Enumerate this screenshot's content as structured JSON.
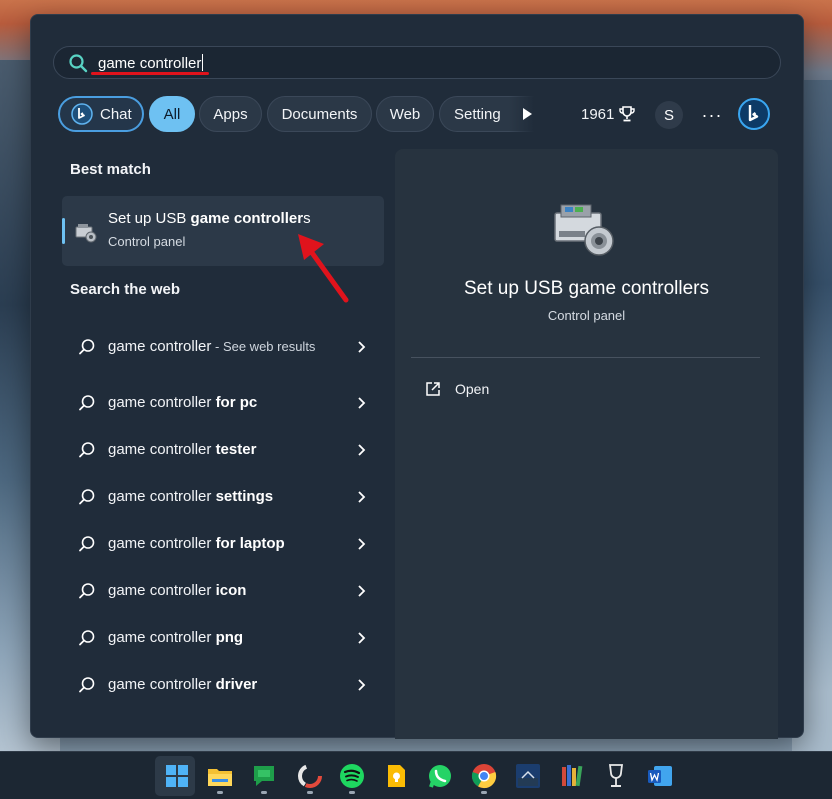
{
  "search": {
    "query": "game controller"
  },
  "filters": {
    "chat": "Chat",
    "all": "All",
    "apps": "Apps",
    "documents": "Documents",
    "web": "Web",
    "settings": "Setting",
    "points": "1961",
    "avatar_initial": "S",
    "more": "···"
  },
  "best_match": {
    "section_label": "Best match",
    "title_prefix": "Set up USB ",
    "title_bold": "game controller",
    "title_suffix": "s",
    "subtitle": "Control panel"
  },
  "search_web": {
    "section_label": "Search the web",
    "items": [
      {
        "prefix": "game controller",
        "bold": "",
        "suffix": " - See web results"
      },
      {
        "prefix": "game controller ",
        "bold": "for pc",
        "suffix": ""
      },
      {
        "prefix": "game controller ",
        "bold": "tester",
        "suffix": ""
      },
      {
        "prefix": "game controller ",
        "bold": "settings",
        "suffix": ""
      },
      {
        "prefix": "game controller ",
        "bold": "for laptop",
        "suffix": ""
      },
      {
        "prefix": "game controller ",
        "bold": "icon",
        "suffix": ""
      },
      {
        "prefix": "game controller ",
        "bold": "png",
        "suffix": ""
      },
      {
        "prefix": "game controller ",
        "bold": "driver",
        "suffix": ""
      }
    ]
  },
  "preview": {
    "title": "Set up USB game controllers",
    "subtitle": "Control panel",
    "open_label": "Open"
  },
  "taskbar": {
    "apps": [
      "windows-start-icon",
      "file-explorer-icon",
      "google-chat-icon",
      "davinci-icon",
      "spotify-icon",
      "keep-icon",
      "whatsapp-icon",
      "chrome-icon",
      "kindle-icon",
      "library-icon",
      "wine-glass-icon",
      "word-icon"
    ]
  },
  "colors": {
    "accent": "#6ec1f2",
    "panel": "#202c3a",
    "annotation_red": "#e0131c"
  }
}
